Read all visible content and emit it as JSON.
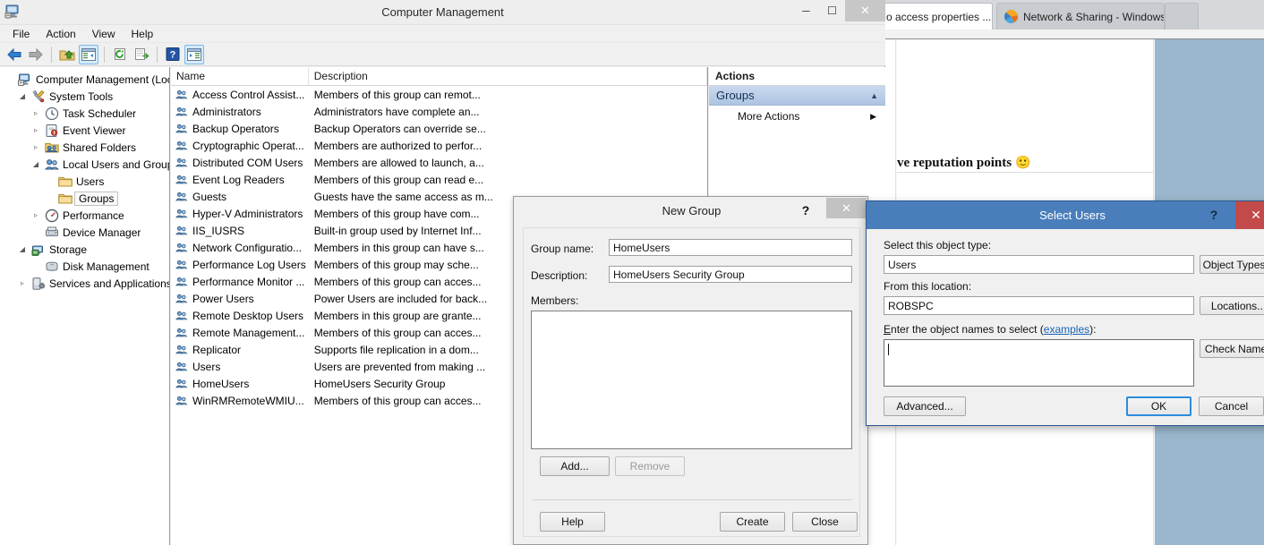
{
  "browser": {
    "tabs": [
      {
        "label": "o access properties ...",
        "close": "✕",
        "icon": "page-icon",
        "active": true
      },
      {
        "label": "Network & Sharing - Windows...",
        "icon": "firefox-icon",
        "active": false
      }
    ],
    "page_text": "ve reputation points",
    "page_emoji": "🙂"
  },
  "window": {
    "title": "Computer Management",
    "app_icon": "computer-management-icon",
    "minimize": "─",
    "maximize": "☐",
    "close": "✕",
    "menus": [
      "File",
      "Action",
      "View",
      "Help"
    ],
    "toolbar_icons": [
      "back-arrow-icon",
      "forward-arrow-icon",
      "separator",
      "up-folder-icon",
      "show-hide-tree-icon",
      "separator",
      "refresh-icon",
      "export-list-icon",
      "separator",
      "help-icon",
      "show-hide-action-pane-icon"
    ]
  },
  "tree": {
    "nodes": [
      {
        "label": "Computer Management (Local",
        "depth": 0,
        "twist": "",
        "icon": "computer-icon"
      },
      {
        "label": "System Tools",
        "depth": 1,
        "twist": "◢",
        "icon": "tools-icon"
      },
      {
        "label": "Task Scheduler",
        "depth": 2,
        "twist": "▹",
        "icon": "clock-icon"
      },
      {
        "label": "Event Viewer",
        "depth": 2,
        "twist": "▹",
        "icon": "event-viewer-icon"
      },
      {
        "label": "Shared Folders",
        "depth": 2,
        "twist": "▹",
        "icon": "shared-folders-icon"
      },
      {
        "label": "Local Users and Groups",
        "depth": 2,
        "twist": "◢",
        "icon": "users-groups-icon"
      },
      {
        "label": "Users",
        "depth": 3,
        "twist": "",
        "icon": "folder-icon"
      },
      {
        "label": "Groups",
        "depth": 3,
        "twist": "",
        "icon": "folder-icon",
        "selected": true
      },
      {
        "label": "Performance",
        "depth": 2,
        "twist": "▹",
        "icon": "performance-icon"
      },
      {
        "label": "Device Manager",
        "depth": 2,
        "twist": "",
        "icon": "device-manager-icon"
      },
      {
        "label": "Storage",
        "depth": 1,
        "twist": "◢",
        "icon": "storage-icon"
      },
      {
        "label": "Disk Management",
        "depth": 2,
        "twist": "",
        "icon": "disk-icon"
      },
      {
        "label": "Services and Applications",
        "depth": 1,
        "twist": "▹",
        "icon": "services-icon"
      }
    ]
  },
  "list": {
    "columns": [
      "Name",
      "Description"
    ],
    "rows": [
      {
        "name": "Access Control Assist...",
        "desc": "Members of this group can remot..."
      },
      {
        "name": "Administrators",
        "desc": "Administrators have complete an..."
      },
      {
        "name": "Backup Operators",
        "desc": "Backup Operators can override se..."
      },
      {
        "name": "Cryptographic Operat...",
        "desc": "Members are authorized to perfor..."
      },
      {
        "name": "Distributed COM Users",
        "desc": "Members are allowed to launch, a..."
      },
      {
        "name": "Event Log Readers",
        "desc": "Members of this group can read e..."
      },
      {
        "name": "Guests",
        "desc": "Guests have the same access as m..."
      },
      {
        "name": "Hyper-V Administrators",
        "desc": "Members of this group have com..."
      },
      {
        "name": "IIS_IUSRS",
        "desc": "Built-in group used by Internet Inf..."
      },
      {
        "name": "Network Configuratio...",
        "desc": "Members in this group can have s..."
      },
      {
        "name": "Performance Log Users",
        "desc": "Members of this group may sche..."
      },
      {
        "name": "Performance Monitor ...",
        "desc": "Members of this group can acces..."
      },
      {
        "name": "Power Users",
        "desc": "Power Users are included for back..."
      },
      {
        "name": "Remote Desktop Users",
        "desc": "Members in this group are grante..."
      },
      {
        "name": "Remote Management...",
        "desc": "Members of this group can acces..."
      },
      {
        "name": "Replicator",
        "desc": "Supports file replication in a dom..."
      },
      {
        "name": "Users",
        "desc": "Users are prevented from making ..."
      },
      {
        "name": "HomeUsers",
        "desc": "HomeUsers Security Group"
      },
      {
        "name": "WinRMRemoteWMIU...",
        "desc": "Members of this group can acces..."
      }
    ]
  },
  "actions": {
    "header": "Actions",
    "group_title": "Groups",
    "group_caret": "▲",
    "items": [
      {
        "label": "More Actions",
        "caret": "▶"
      }
    ]
  },
  "new_group_dialog": {
    "title": "New Group",
    "help": "?",
    "close": "✕",
    "group_name_label": "Group name:",
    "group_name_value": "HomeUsers",
    "description_label": "Description:",
    "description_value": "HomeUsers Security Group",
    "members_label": "Members:",
    "members_items": [],
    "add_button": "Add...",
    "remove_button": "Remove",
    "help_button": "Help",
    "create_button": "Create",
    "close_button": "Close"
  },
  "select_users_dialog": {
    "title": "Select Users",
    "help": "?",
    "close": "✕",
    "object_type_label": "Select this object type:",
    "object_type_value": "Users",
    "object_types_button": "Object Types...",
    "location_label": "From this location:",
    "location_value": "ROBSPC",
    "locations_button": "Locations...",
    "names_label_pre": "E",
    "names_label_mid": "nter the object names to select (",
    "names_label_link": "examples",
    "names_label_post": "):",
    "names_value": "",
    "check_names_button": "Check Names",
    "advanced_button": "Advanced...",
    "ok_button": "OK",
    "cancel_button": "Cancel"
  },
  "colors": {
    "dialog_title_blue": "#4a7ebb",
    "close_red": "#c34a4a",
    "accent_blue": "#2a8cdd",
    "action_group_blue": "#aec4e2",
    "browser_panel": "#9ab7cd"
  }
}
